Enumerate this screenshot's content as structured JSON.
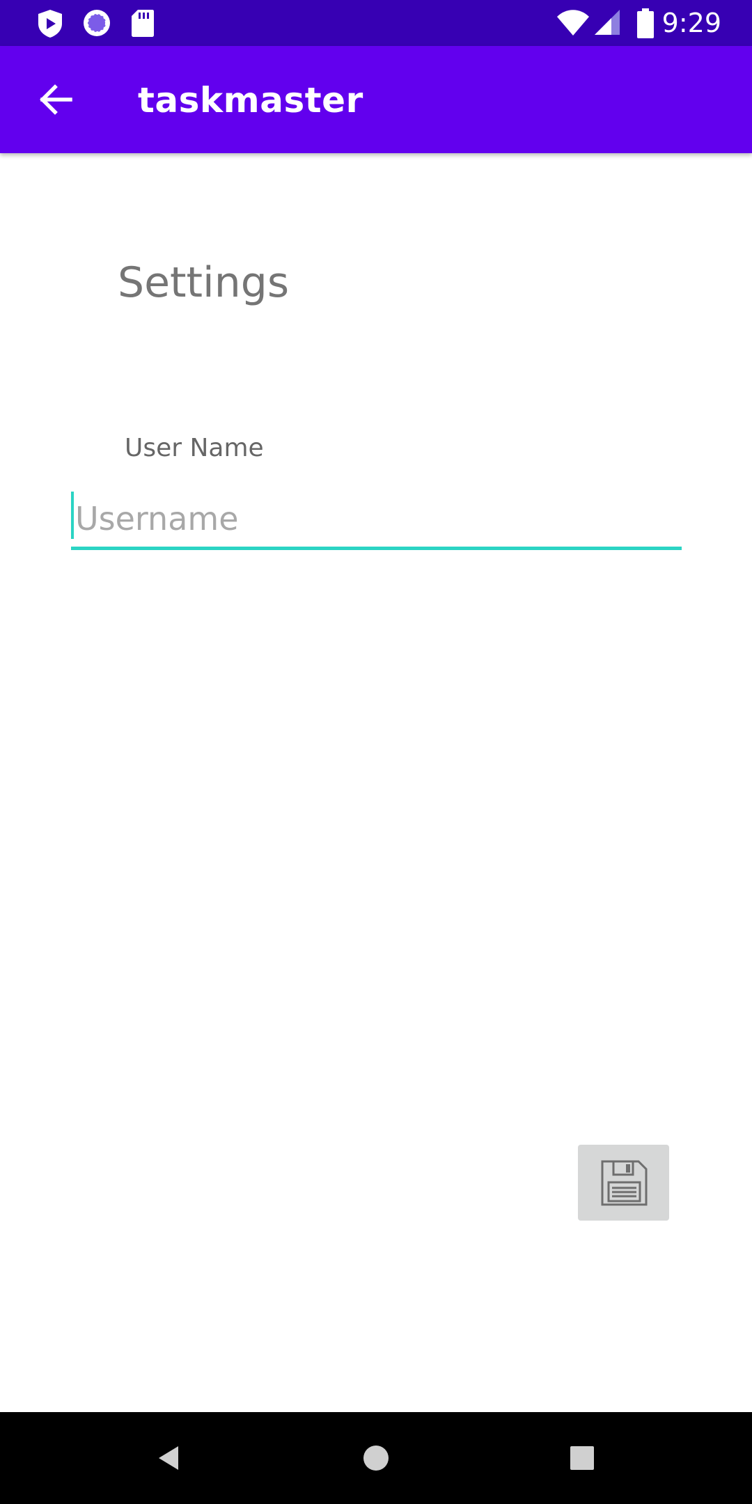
{
  "status_bar": {
    "time": "9:29",
    "icons": [
      "shield-play-icon",
      "sync-circle-icon",
      "sd-card-icon",
      "wifi-icon",
      "cellular-signal-icon",
      "battery-icon"
    ]
  },
  "app_bar": {
    "title": "taskmaster",
    "back_icon": "arrow-back-icon",
    "color": "#6200EE"
  },
  "main": {
    "heading": "Settings",
    "user_name_label": "User Name",
    "username_input": {
      "value": "",
      "placeholder": "Username",
      "underline_color": "#2BD4C4"
    },
    "save_button_icon": "floppy-disk-icon"
  },
  "nav_bar": {
    "buttons": [
      "back-triangle-icon",
      "home-circle-icon",
      "recents-square-icon"
    ]
  },
  "colors": {
    "status_bar": "#3700B3",
    "app_bar": "#6200EE",
    "accent": "#2BD4C4"
  }
}
